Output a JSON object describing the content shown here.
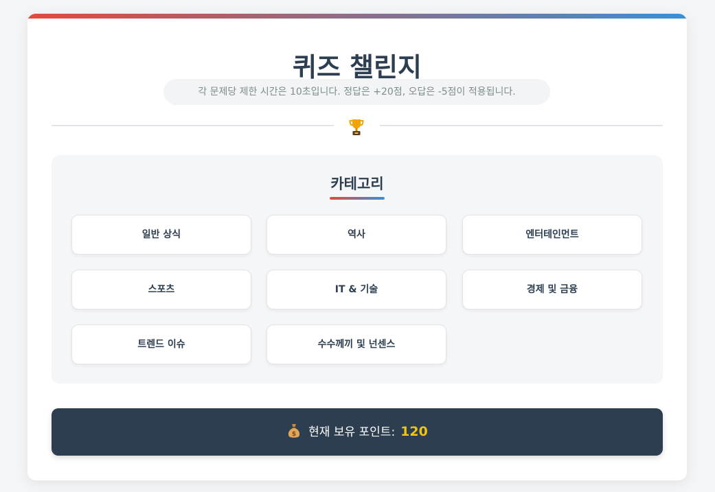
{
  "header": {
    "title": "퀴즈 챌린지",
    "subtitle": "각 문제당 제한 시간은 10초입니다. 정답은 +20점, 오답은 -5점이 적용됩니다."
  },
  "divider": {
    "icon": "trophy-icon"
  },
  "categories": {
    "title": "카테고리",
    "items": [
      {
        "label": "일반 상식"
      },
      {
        "label": "역사"
      },
      {
        "label": "엔터테인먼트"
      },
      {
        "label": "스포츠"
      },
      {
        "label": "IT & 기술"
      },
      {
        "label": "경제 및 금융"
      },
      {
        "label": "트렌드 이슈"
      },
      {
        "label": "수수께끼 및 넌센스"
      }
    ]
  },
  "points": {
    "icon": "money-bag-icon",
    "label": "현재 보유 포인트:",
    "value": "120"
  },
  "colors": {
    "gradient_start": "#e04b3c",
    "gradient_end": "#3a8fd6",
    "dark_navy": "#2c3e50",
    "gold": "#f1c40f"
  }
}
